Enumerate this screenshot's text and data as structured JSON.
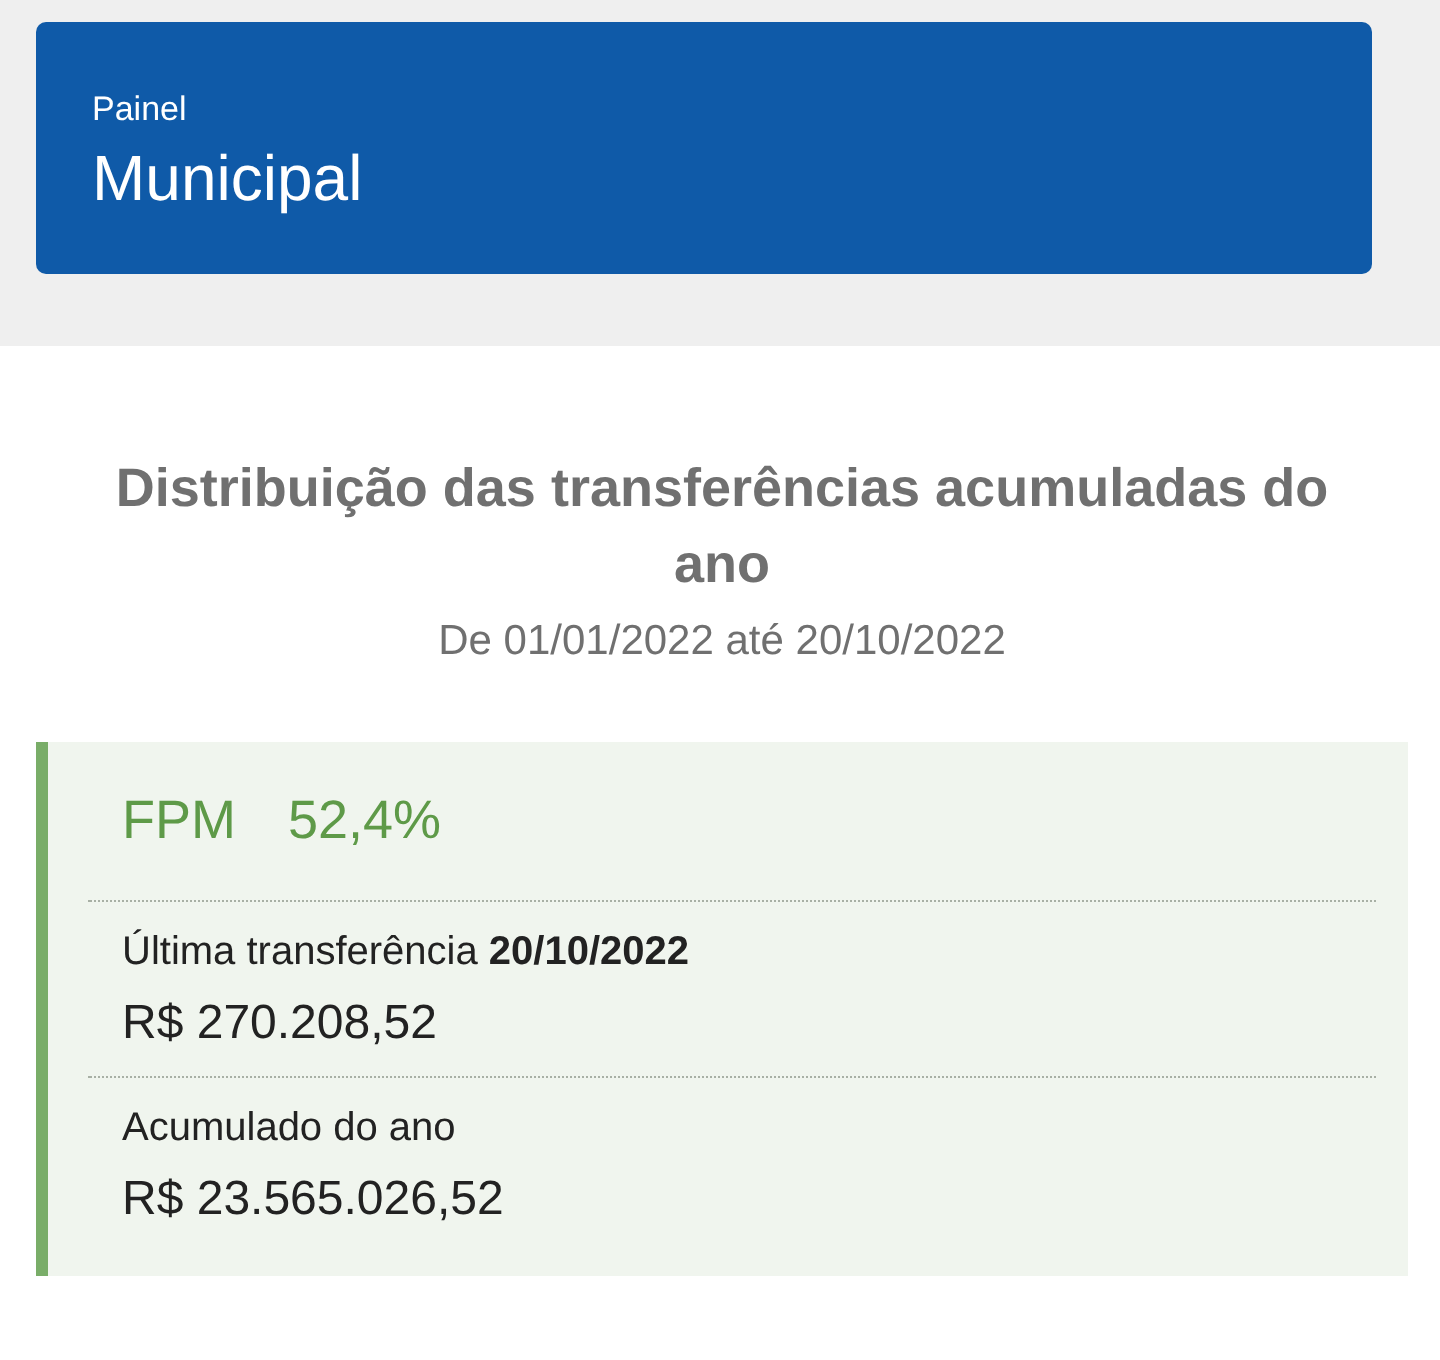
{
  "header": {
    "subtitle": "Painel",
    "title": "Municipal"
  },
  "section": {
    "title": "Distribuição das transferências acumuladas do ano",
    "period": "De 01/01/2022 até 20/10/2022"
  },
  "card": {
    "name": "FPM",
    "percent": "52,4%",
    "rows": [
      {
        "label": "Última transferência **20/10/2022**",
        "value": "R$ 270.208,52"
      },
      {
        "label": "Acumulado do ano",
        "value": "R$ 23.565.026,52"
      }
    ]
  }
}
